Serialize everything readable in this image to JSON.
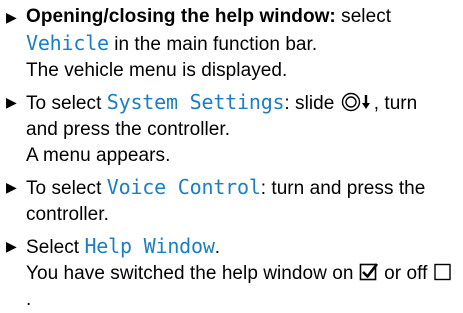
{
  "steps": [
    {
      "lead": "Opening/closing the help window:",
      "text_a": " select ",
      "term": "Vehicle",
      "text_b": " in the main function bar.",
      "result": "The vehicle menu is displayed."
    },
    {
      "text_a": "To select ",
      "term": "System Settings",
      "text_b": ": slide ",
      "text_c": ", turn and press the controller.",
      "result": "A menu appears."
    },
    {
      "text_a": "To select ",
      "term": "Voice Control",
      "text_b": ": turn and press the controller."
    },
    {
      "text_a": "Select ",
      "term": "Help Window",
      "text_b": ".",
      "result_a": "You have switched the help window on ",
      "result_b": " or off ",
      "result_c": "."
    }
  ],
  "icons": {
    "bullet": "triangle-bullet-icon",
    "controller": "controller-slide-down-icon",
    "checked": "checkbox-checked-icon",
    "unchecked": "checkbox-unchecked-icon"
  },
  "colors": {
    "ui_term": "#1a7fc4",
    "text": "#000000"
  }
}
